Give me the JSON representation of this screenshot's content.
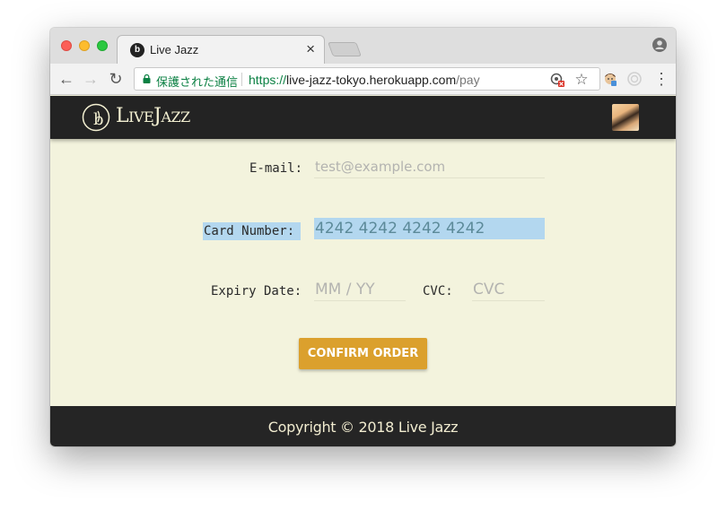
{
  "browser": {
    "tab": {
      "title": "Live Jazz",
      "favicon_letter": "b",
      "close_glyph": "×"
    },
    "toolbar": {
      "back_glyph": "←",
      "forward_glyph": "→",
      "reload_glyph": "↻",
      "secure_label": "保護された通信",
      "url_scheme": "https://",
      "url_host": "live-jazz-tokyo.herokuapp.com",
      "url_path": "/pay",
      "star_glyph": "☆",
      "menu_glyph": "⋮"
    }
  },
  "site": {
    "logo_letter": "b",
    "logo": {
      "l": "L",
      "ive": "IVE",
      "j": "J",
      "azz": "AZZ"
    }
  },
  "form": {
    "email": {
      "label": "E-mail:",
      "placeholder": "test@example.com"
    },
    "card_number": {
      "label": "Card Number:",
      "value": "4242 4242 4242 4242"
    },
    "expiry": {
      "label": "Expiry Date:",
      "placeholder": "MM / YY"
    },
    "cvc": {
      "label": "CVC:",
      "placeholder": "CVC"
    },
    "confirm_label": "CONFIRM ORDER"
  },
  "footer": {
    "text": "Copyright © 2018 Live Jazz"
  },
  "colors": {
    "page_bg": "#f3f3dd",
    "header_bg": "#232323",
    "button_bg": "#dba02d",
    "selection": "#b3d7ef",
    "secure_green": "#0b8043"
  },
  "icons": {
    "traffic_lights": [
      "close-icon",
      "minimize-icon",
      "maximize-icon"
    ],
    "omnibox": [
      "lock-icon",
      "translate-icon",
      "star-icon"
    ],
    "extensions": [
      "extension-avatar-icon",
      "extension-disabled-icon"
    ],
    "profile": "profile-icon"
  }
}
